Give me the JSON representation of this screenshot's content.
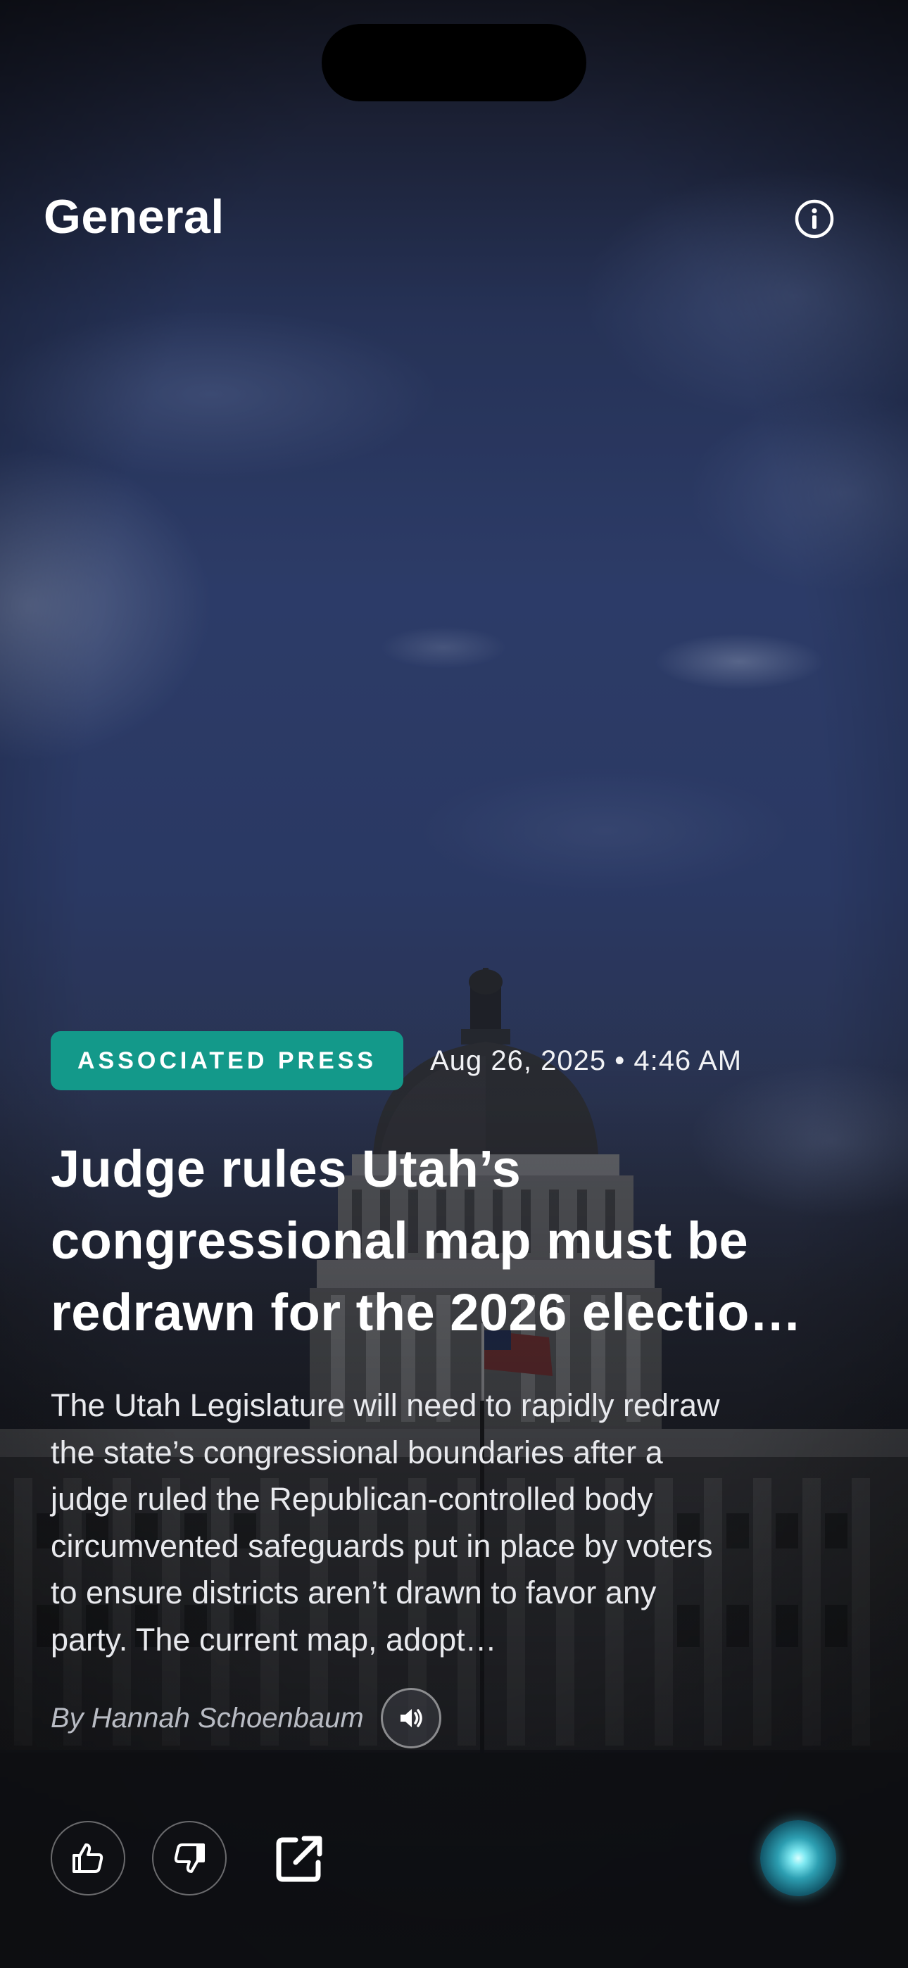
{
  "header": {
    "title": "General",
    "info_icon": "info-circle-icon"
  },
  "article": {
    "source": "ASSOCIATED PRESS",
    "timestamp": "Aug 26, 2025 • 4:46 AM",
    "headline_lines": [
      "Judge rules Utah’s",
      "congressional map must be",
      "redrawn for the 2026 electio…"
    ],
    "summary_lines": [
      "The Utah Legislature will need to rapidly redraw",
      "the state’s congressional boundaries after a",
      "judge ruled the Republican-controlled body",
      "circumvented safeguards put in place by voters",
      "to ensure districts aren’t drawn to favor any",
      "party. The current map, adopt…"
    ],
    "byline": "By Hannah Schoenbaum",
    "audio_icon": "speaker-icon"
  },
  "actions": {
    "like_icon": "thumbs-up-icon",
    "dislike_icon": "thumbs-down-icon",
    "open_icon": "open-external-icon",
    "assistant_icon": "assistant-orb-icon"
  },
  "colors": {
    "source_badge": "#13998a",
    "sky": "#3a4f8c",
    "background": "#15171c"
  }
}
